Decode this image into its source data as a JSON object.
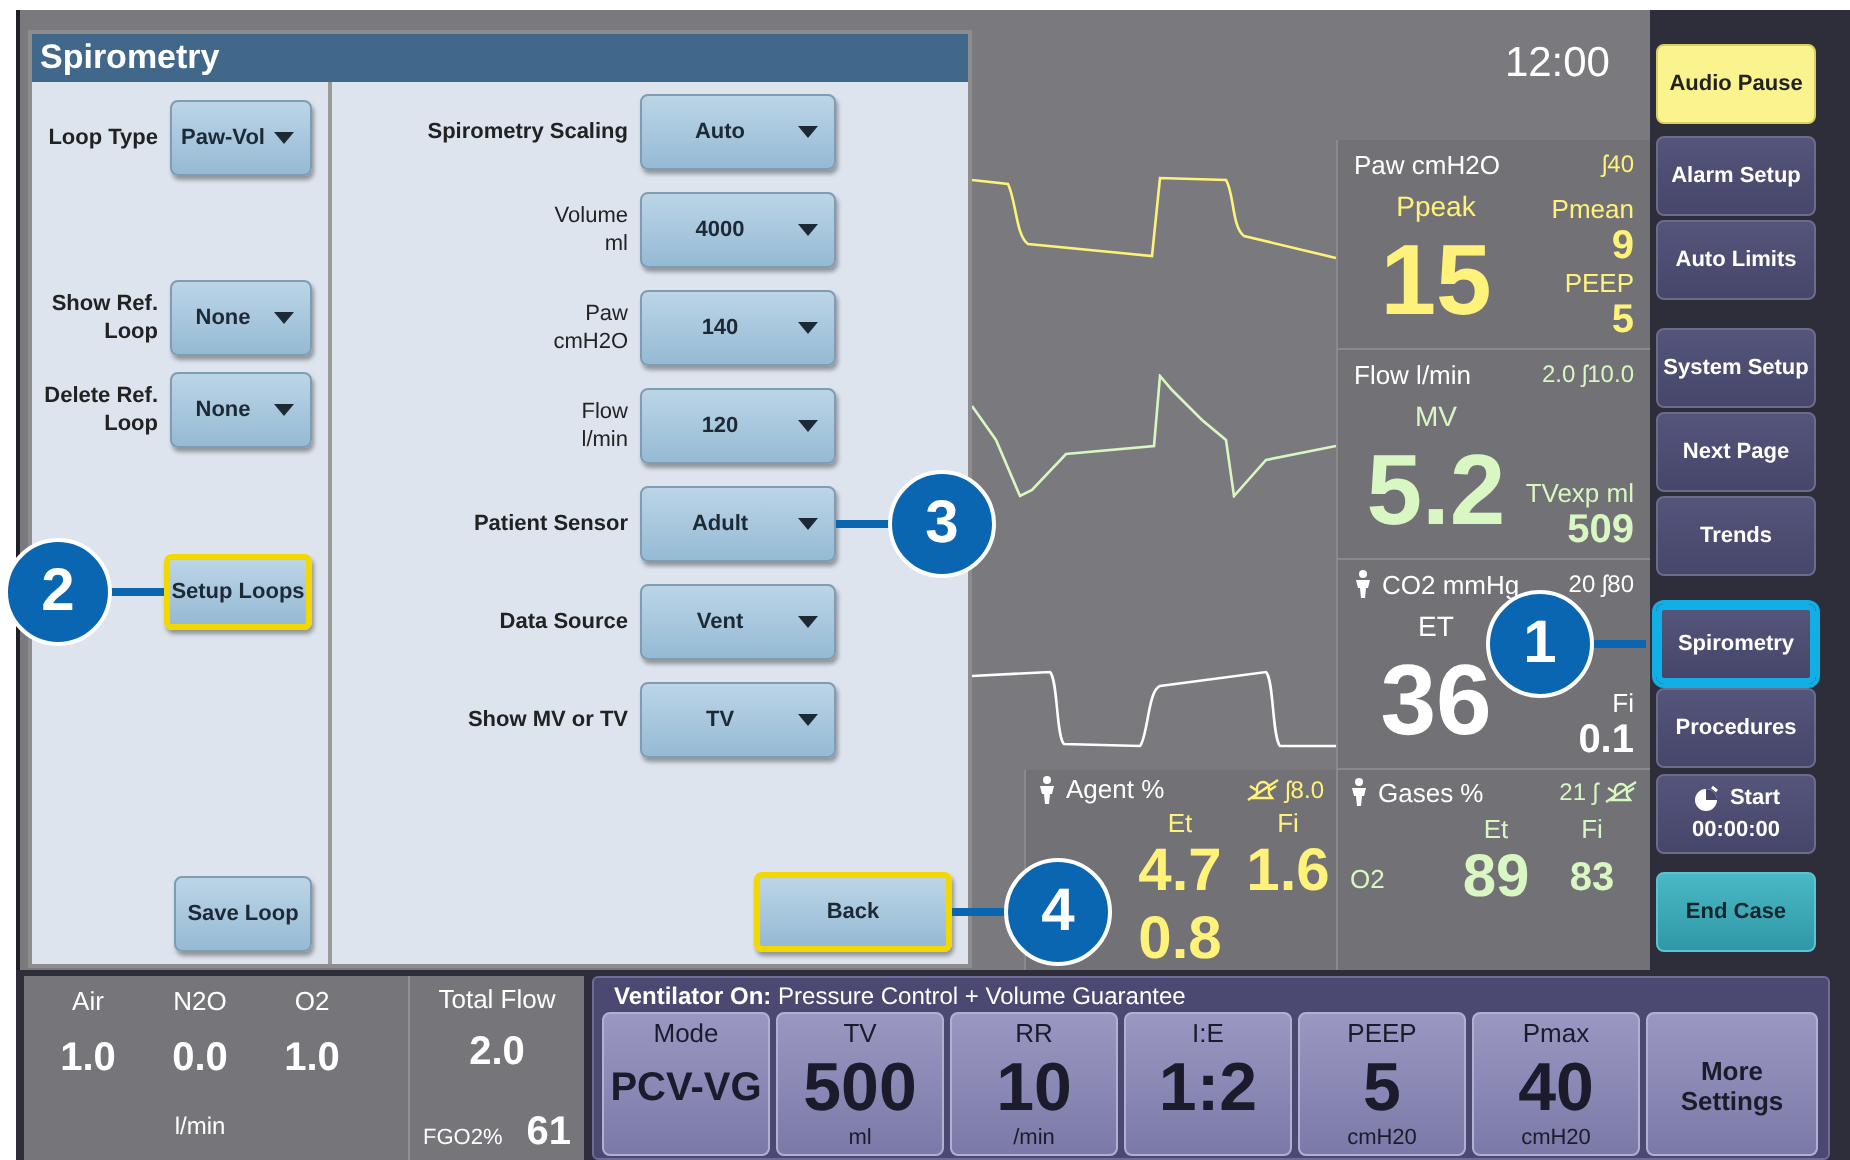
{
  "display": {
    "clock": "12:00",
    "parameters": [
      {
        "kind": "pressure",
        "label": "Paw cmH2O",
        "patient_icon": false,
        "limits": [
          {
            "kind": "text",
            "text": "ʃ40"
          }
        ],
        "color": "#fff27a",
        "main": {
          "label": "Ppeak",
          "value": "15"
        },
        "side": [
          {
            "label": "Pmean",
            "value": "9"
          },
          {
            "label": "PEEP",
            "value": "5"
          }
        ]
      },
      {
        "kind": "flow",
        "label": "Flow l/min",
        "patient_icon": false,
        "limits": [
          {
            "kind": "text",
            "text": "2.0 ʃ10.0"
          }
        ],
        "color": "#d8f7c2",
        "main": {
          "label": "MV",
          "value": "5.2"
        },
        "side": [
          {
            "label": "TVexp ml",
            "value": "509"
          }
        ]
      },
      {
        "kind": "co2",
        "label": "CO2 mmHg",
        "patient_icon": true,
        "limits": [
          {
            "kind": "text",
            "text": "20 ʃ80"
          }
        ],
        "color": "#ffffff",
        "main": {
          "label": "ET",
          "value": "36"
        },
        "side": [
          {
            "label": "Fi",
            "value": "0.1"
          }
        ]
      }
    ],
    "gases": [
      {
        "label": "Agent %",
        "patient_icon": true,
        "limits": [
          {
            "kind": "bell"
          },
          {
            "kind": "text",
            "text": "ʃ8.0"
          }
        ],
        "color": "#fff27a",
        "columns": [
          "Et",
          "Fi"
        ],
        "rows": [
          {
            "values": [
              "4.7",
              "1.6"
            ]
          },
          {
            "values": [
              "0.8"
            ]
          }
        ]
      },
      {
        "label": "Gases %",
        "patient_icon": true,
        "limits": [
          {
            "kind": "text",
            "text": "21 ʃ"
          },
          {
            "kind": "bell"
          }
        ],
        "color": "#d8f7c2",
        "columns": [
          "Et",
          "Fi"
        ],
        "rows": [
          {
            "name": "O2",
            "values": [
              "89",
              "83"
            ]
          }
        ]
      }
    ]
  },
  "dialog": {
    "title": "Spirometry",
    "left_settings": [
      {
        "label": "Loop Type",
        "value": "Paw-Vol"
      },
      {
        "label": "Show Ref.\nLoop",
        "value": "None"
      },
      {
        "label": "Delete Ref.\nLoop",
        "value": "None"
      }
    ],
    "left_buttons": [
      {
        "label": "Setup Loops",
        "highlighted": true,
        "callout": "2"
      },
      {
        "label": "Save Loop",
        "highlighted": false
      }
    ],
    "right_settings": [
      {
        "kind": "main",
        "label": "Spirometry Scaling",
        "value": "Auto"
      },
      {
        "kind": "sub",
        "label": "Volume\nml",
        "value": "4000"
      },
      {
        "kind": "sub",
        "label": "Paw\ncmH2O",
        "value": "140"
      },
      {
        "kind": "sub",
        "label": "Flow\nl/min",
        "value": "120"
      },
      {
        "kind": "main",
        "label": "Patient Sensor",
        "value": "Adult",
        "callout": "3"
      },
      {
        "kind": "main",
        "label": "Data Source",
        "value": "Vent"
      },
      {
        "kind": "main",
        "label": "Show MV or TV",
        "value": "TV"
      }
    ],
    "back_button": {
      "label": "Back",
      "highlighted": true,
      "callout": "4"
    }
  },
  "sidebar": [
    {
      "kind": "alert",
      "label": "Audio Pause",
      "highlighted": false
    },
    {
      "kind": "normal",
      "label": "Alarm Setup",
      "highlighted": false
    },
    {
      "kind": "normal",
      "label": "Auto Limits",
      "highlighted": false
    },
    {
      "kind": "normal",
      "label": "System Setup",
      "highlighted": false
    },
    {
      "kind": "normal",
      "label": "Next Page",
      "highlighted": false
    },
    {
      "kind": "normal",
      "label": "Trends",
      "highlighted": false
    },
    {
      "kind": "normal",
      "label": "Spirometry",
      "highlighted": true,
      "callout": "1"
    },
    {
      "kind": "normal",
      "label": "Procedures",
      "highlighted": false
    },
    {
      "kind": "timer",
      "label": "Start",
      "value": "00:00:00",
      "highlighted": false
    },
    {
      "kind": "end",
      "label": "End Case",
      "highlighted": false
    }
  ],
  "fresh_gas": {
    "gases": [
      {
        "label": "Air",
        "value": "1.0"
      },
      {
        "label": "N2O",
        "value": "0.0"
      },
      {
        "label": "O2",
        "value": "1.0"
      }
    ],
    "unit": "l/min",
    "total_flow": {
      "label": "Total Flow",
      "value": "2.0"
    },
    "fgo2": {
      "label": "FGO2%",
      "value": "61"
    }
  },
  "ventilator": {
    "status": "**Ventilator On:** Pressure Control + Volume Guarantee",
    "settings": [
      {
        "kind": "mode",
        "label": "Mode",
        "value": "PCV-VG"
      },
      {
        "kind": "setting",
        "label": "TV",
        "value": "500",
        "unit": "ml"
      },
      {
        "kind": "setting",
        "label": "RR",
        "value": "10",
        "unit": "/min"
      },
      {
        "kind": "setting",
        "label": "I:E",
        "value": "1:2"
      },
      {
        "kind": "setting",
        "label": "PEEP",
        "value": "5",
        "unit": "cmH20"
      },
      {
        "kind": "setting",
        "label": "Pmax",
        "value": "40",
        "unit": "cmH20"
      },
      {
        "kind": "menu",
        "label": "More Settings"
      }
    ]
  }
}
